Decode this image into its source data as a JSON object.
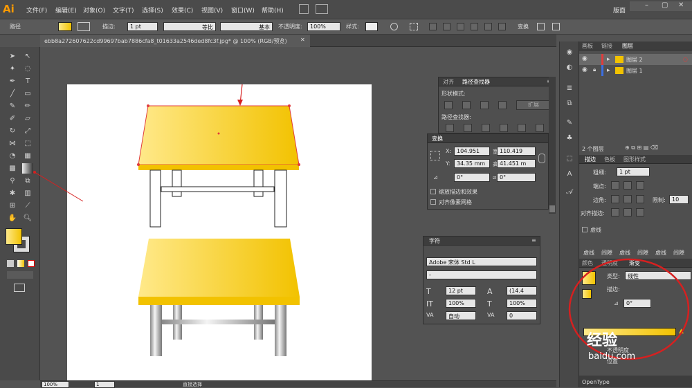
{
  "app": {
    "logo": "Ai"
  },
  "menu": [
    "文件(F)",
    "编辑(E)",
    "对象(O)",
    "文字(T)",
    "选择(S)",
    "效果(C)",
    "视图(V)",
    "窗口(W)",
    "帮助(H)"
  ],
  "workspace": "版面",
  "control": {
    "mode": "路径",
    "stroke_label": "描边:",
    "stroke_value": "1 pt",
    "profile": "等比",
    "brush": "基本",
    "opacity_label": "不透明度:",
    "opacity_value": "100%",
    "style_label": "样式:",
    "transform": "变换"
  },
  "document": {
    "tab_title": "ebb8a272607622cd99697bab7886cfa8_t01633a2546ded8fc3f.jpg* @ 100% (RGB/预览)"
  },
  "status": {
    "zoom": "100%",
    "page": "1",
    "tool": "直接选择"
  },
  "pathfinder": {
    "tab_align": "对齐",
    "tab_pathfinder": "路径查找器",
    "shape_modes": "形状模式:",
    "expand": "扩展",
    "pathfinders": "路径查找器:"
  },
  "transform": {
    "tab": "变换",
    "x_label": "X:",
    "x": "104.951",
    "w_label": "宽:",
    "w": "110.419",
    "y_label": "Y:",
    "y": "34.35 mm",
    "h_label": "高:",
    "h": "41.451 m",
    "angle1": "0°",
    "angle2": "0°",
    "scale_strokes": "缩放描边和效果",
    "align_pixel": "对齐像素网格"
  },
  "character": {
    "tab": "字符",
    "font": "Adobe 宋体 Std L",
    "style": "-",
    "size": "12 pt",
    "leading": "(14.4",
    "hscale": "100%",
    "vscale": "100%",
    "tracking": "自动",
    "kerning": "0"
  },
  "layers": {
    "tab_artboard": "画板",
    "tab_links": "链接",
    "tab_layers": "图层",
    "items": [
      {
        "name": "图层 2",
        "color": "#e03c3c"
      },
      {
        "name": "图层 1",
        "color": "#3c6fe0"
      }
    ],
    "count": "2 个图层"
  },
  "stroke": {
    "tab_stroke": "描边",
    "tab_swatch": "色板",
    "tab_graphic": "图形样式",
    "weight_label": "粗细:",
    "weight": "1 pt",
    "cap_label": "端点:",
    "corner_label": "边角:",
    "limit_label": "限制:",
    "limit": "10",
    "align_label": "对齐描边:",
    "dashed": "虚线",
    "dash_labels": [
      "虚线",
      "间隙",
      "虚线",
      "间隙",
      "虚线",
      "间隙"
    ]
  },
  "gradient": {
    "tab_color": "颜色",
    "tab_transparency": "透明度",
    "tab_gradient": "渐变",
    "type_label": "类型:",
    "type": "线性",
    "stroke_label": "描边:",
    "angle": "0°",
    "opacity_label": "不透明度",
    "location_label": "位置"
  },
  "bottom_label": "OpenType",
  "watermark": {
    "text": "经验",
    "sub": "baidu.com"
  },
  "colors": {
    "accent": "#f2c200",
    "highlight": "#ffe98a",
    "annot": "#d62020"
  }
}
